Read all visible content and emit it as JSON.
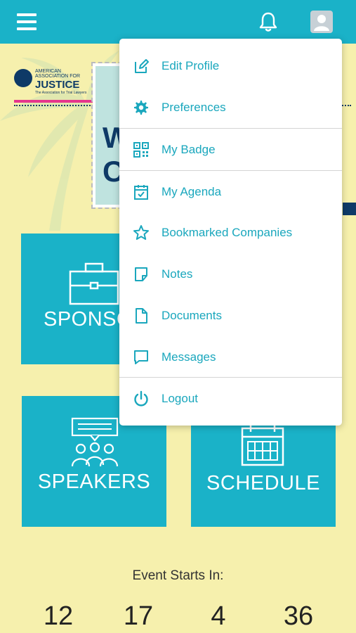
{
  "header": {
    "menu_icon": "hamburger-icon",
    "bell_icon": "bell-icon",
    "avatar_icon": "user-avatar-icon",
    "accent": "#1ab2c8"
  },
  "banner": {
    "logo_line1": "AMERICAN",
    "logo_line2": "ASSOCIATION FOR",
    "logo_big": "JUSTICE",
    "logo_tag": "The Association for Trial Lawyers",
    "stamp_letters_1": "W",
    "stamp_letters_2": "C"
  },
  "tiles": {
    "sponsors": "SPONSO",
    "speakers": "SPEAKERS",
    "schedule": "SCHEDULE"
  },
  "countdown": {
    "title": "Event Starts In:",
    "values": [
      "12",
      "17",
      "4",
      "36"
    ]
  },
  "menu": {
    "items": [
      {
        "label": "Edit Profile",
        "icon": "edit-icon"
      },
      {
        "label": "Preferences",
        "icon": "gear-icon"
      },
      {
        "label": "My Badge",
        "icon": "qr-code-icon"
      },
      {
        "label": "My Agenda",
        "icon": "calendar-check-icon"
      },
      {
        "label": "Bookmarked Companies",
        "icon": "star-icon"
      },
      {
        "label": "Notes",
        "icon": "note-icon"
      },
      {
        "label": "Documents",
        "icon": "document-icon"
      },
      {
        "label": "Messages",
        "icon": "message-icon"
      },
      {
        "label": "Logout",
        "icon": "power-icon"
      }
    ],
    "accent": "#1aa7bd"
  }
}
